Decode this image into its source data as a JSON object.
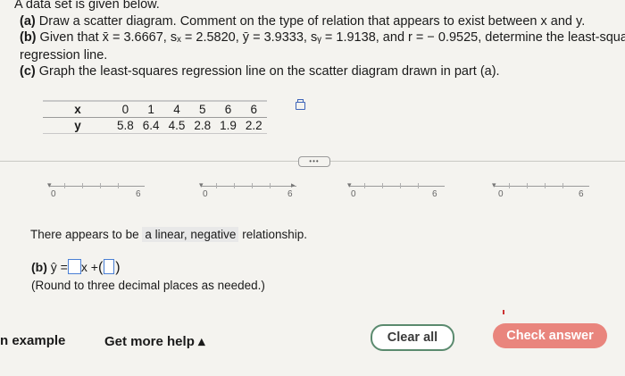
{
  "problem": {
    "intro": "A data set is given below.",
    "part_a_label": "(a)",
    "part_a_text": "Draw a scatter diagram. Comment on the type of relation that appears to exist between x and y.",
    "part_b_label": "(b)",
    "part_b_text": "Given that x̄ = 3.6667, sₓ = 2.5820, ȳ = 3.9333, sᵧ = 1.9138, and r = − 0.9525, determine the least-squares",
    "part_b_text2": "regression line.",
    "part_c_label": "(c)",
    "part_c_text": "Graph the least-squares regression line on the scatter diagram drawn in part (a)."
  },
  "table": {
    "x_label": "x",
    "y_label": "y",
    "x_values": [
      "0",
      "1",
      "4",
      "5",
      "6",
      "6"
    ],
    "y_values": [
      "5.8",
      "6.4",
      "4.5",
      "2.8",
      "1.9",
      "2.2"
    ]
  },
  "expand_label": "•••",
  "graphs": [
    {
      "left_label": "0",
      "right_label": "6"
    },
    {
      "left_label": "0",
      "right_label": "6"
    },
    {
      "left_label": "0",
      "right_label": "6"
    },
    {
      "left_label": "0",
      "right_label": "6"
    }
  ],
  "answer_a": {
    "prefix": "There appears to be",
    "selected": "a linear, negative",
    "suffix": "relationship."
  },
  "answer_b": {
    "label": "(b)",
    "equation_start": "ŷ =",
    "middle": "x +",
    "note": "(Round to three decimal places as needed.)"
  },
  "footer": {
    "example_link": "n example",
    "help_link": "Get more help ▴",
    "clear_button": "Clear all",
    "check_button": "Check answer"
  }
}
